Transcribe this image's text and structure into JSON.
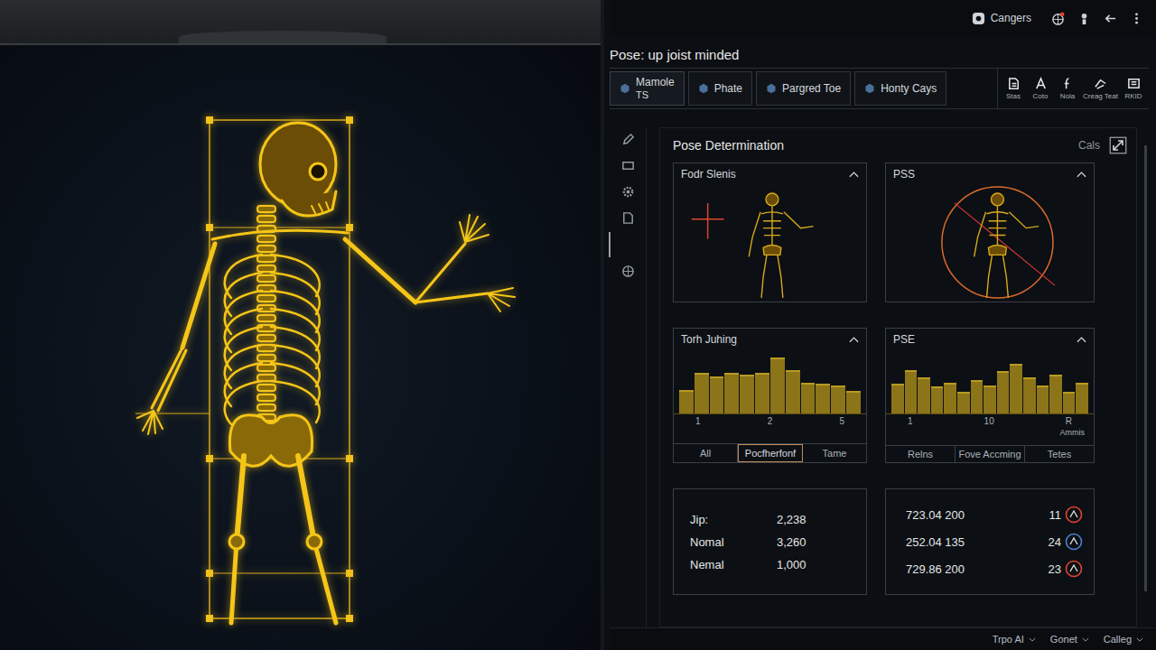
{
  "topbar": {
    "account": "Cangers"
  },
  "title": "Pose: up joist minded",
  "tabs": [
    {
      "label": "Mamole",
      "sub": "TS",
      "selected": true
    },
    {
      "label": "Phate",
      "sub": "",
      "selected": false
    },
    {
      "label": "Pargred Toe",
      "sub": "",
      "selected": false
    },
    {
      "label": "Honty Cays",
      "sub": "",
      "selected": false
    }
  ],
  "tools": [
    "Stas",
    "Coto",
    "Nola",
    "Creag Teat",
    "RKID"
  ],
  "panel": {
    "title": "Pose Determination",
    "action": "Cals"
  },
  "cards": [
    {
      "title": "Fodr Slenis"
    },
    {
      "title": "PSS"
    }
  ],
  "charts": [
    {
      "title": "Torh Juhing",
      "values": [
        35,
        62,
        56,
        62,
        58,
        62,
        86,
        66,
        46,
        44,
        41,
        33
      ],
      "ticks": [
        "1",
        "2",
        "5"
      ],
      "unit": "",
      "tabs": [
        {
          "label": "All",
          "selected": false
        },
        {
          "label": "Pocfherfonf",
          "selected": true
        },
        {
          "label": "Tame",
          "selected": false
        }
      ]
    },
    {
      "title": "PSE",
      "values": [
        45,
        66,
        55,
        40,
        46,
        32,
        50,
        41,
        65,
        76,
        55,
        41,
        58,
        32,
        46
      ],
      "ticks": [
        "1",
        "10",
        "R"
      ],
      "unit": "Ammis",
      "tabs": [
        {
          "label": "Relns",
          "selected": false
        },
        {
          "label": "Fove Accming",
          "selected": false
        },
        {
          "label": "Tetes",
          "selected": false
        }
      ]
    }
  ],
  "stats": [
    {
      "label": "Jip:",
      "value": "2,238"
    },
    {
      "label": "Nomal",
      "value": "3,260"
    },
    {
      "label": "Nemal",
      "value": "1,000"
    }
  ],
  "readings": [
    {
      "value": "723.04 200",
      "count": "11",
      "color": "#e0442c"
    },
    {
      "value": "252.04 135",
      "count": "24",
      "color": "#4f7fd0"
    },
    {
      "value": "729.86 200",
      "count": "23",
      "color": "#e0442c"
    }
  ],
  "status_bar": [
    "Trpo AI",
    "Gonet",
    "Calleg"
  ]
}
